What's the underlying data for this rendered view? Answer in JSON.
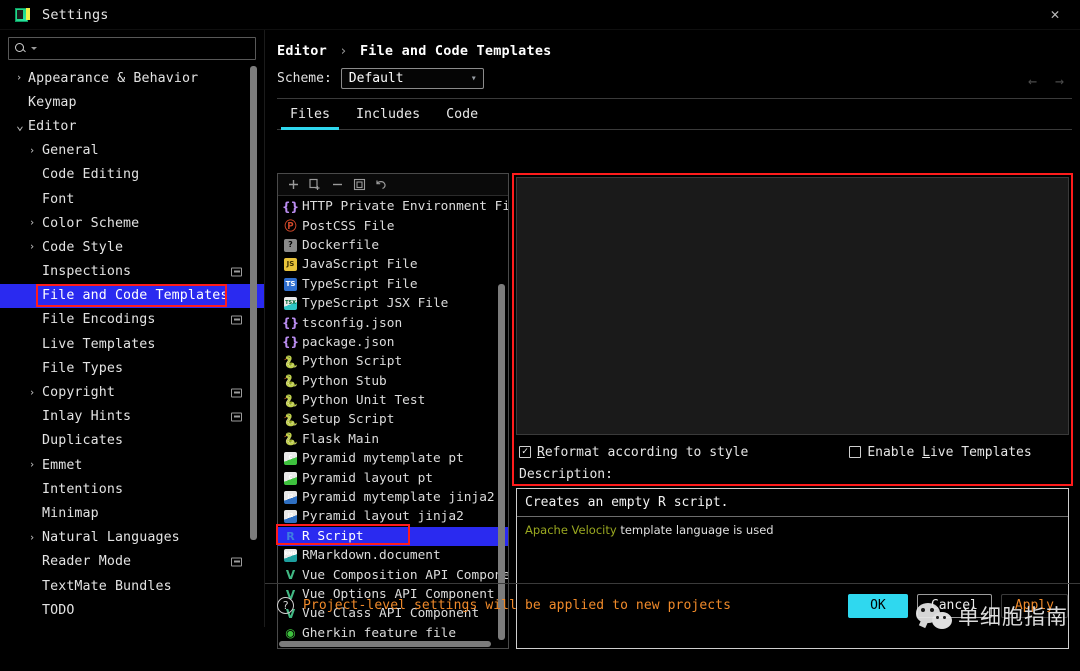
{
  "window": {
    "title": "Settings",
    "app_icon": "pycharm-icon",
    "close_icon": "close-icon"
  },
  "sidebar": {
    "search": {
      "placeholder": "",
      "value": "",
      "icon": "search-icon"
    },
    "items": [
      {
        "label": "Appearance & Behavior",
        "level": 1,
        "arrow": "collapsed",
        "badge": false
      },
      {
        "label": "Keymap",
        "level": 1,
        "arrow": "none",
        "badge": false
      },
      {
        "label": "Editor",
        "level": 1,
        "arrow": "expanded",
        "badge": false
      },
      {
        "label": "General",
        "level": 2,
        "arrow": "collapsed",
        "badge": false
      },
      {
        "label": "Code Editing",
        "level": 2,
        "arrow": "none",
        "badge": false
      },
      {
        "label": "Font",
        "level": 2,
        "arrow": "none",
        "badge": false
      },
      {
        "label": "Color Scheme",
        "level": 2,
        "arrow": "collapsed",
        "badge": false
      },
      {
        "label": "Code Style",
        "level": 2,
        "arrow": "collapsed",
        "badge": false
      },
      {
        "label": "Inspections",
        "level": 2,
        "arrow": "none",
        "badge": true
      },
      {
        "label": "File and Code Templates",
        "level": 2,
        "arrow": "none",
        "badge": false,
        "selected": true
      },
      {
        "label": "File Encodings",
        "level": 2,
        "arrow": "none",
        "badge": true
      },
      {
        "label": "Live Templates",
        "level": 2,
        "arrow": "none",
        "badge": false
      },
      {
        "label": "File Types",
        "level": 2,
        "arrow": "none",
        "badge": false
      },
      {
        "label": "Copyright",
        "level": 2,
        "arrow": "collapsed",
        "badge": true
      },
      {
        "label": "Inlay Hints",
        "level": 2,
        "arrow": "none",
        "badge": true
      },
      {
        "label": "Duplicates",
        "level": 2,
        "arrow": "none",
        "badge": false
      },
      {
        "label": "Emmet",
        "level": 2,
        "arrow": "collapsed",
        "badge": false
      },
      {
        "label": "Intentions",
        "level": 2,
        "arrow": "none",
        "badge": false
      },
      {
        "label": "Minimap",
        "level": 2,
        "arrow": "none",
        "badge": false
      },
      {
        "label": "Natural Languages",
        "level": 2,
        "arrow": "collapsed",
        "badge": false
      },
      {
        "label": "Reader Mode",
        "level": 2,
        "arrow": "none",
        "badge": true
      },
      {
        "label": "TextMate Bundles",
        "level": 2,
        "arrow": "none",
        "badge": false
      },
      {
        "label": "TODO",
        "level": 2,
        "arrow": "none",
        "badge": false
      }
    ]
  },
  "main": {
    "breadcrumb": {
      "parent": "Editor",
      "separator": "›",
      "current": "File and Code Templates"
    },
    "scheme": {
      "label": "Scheme:",
      "value": "Default",
      "chevron": "chevron-down-icon"
    },
    "tabs": [
      {
        "label": "Files",
        "active": true
      },
      {
        "label": "Includes",
        "active": false
      },
      {
        "label": "Code",
        "active": false
      }
    ],
    "nav": {
      "back_icon": "arrow-left-icon",
      "forward_icon": "arrow-right-icon"
    }
  },
  "list_toolbar": {
    "add": "plus-icon",
    "copy": "copy-add-icon",
    "remove": "minus-icon",
    "clone": "clone-icon",
    "reset": "undo-icon"
  },
  "templates": [
    {
      "name": "HTTP Private Environment Fil",
      "icon": "json-braces-icon",
      "kind": "json"
    },
    {
      "name": "PostCSS File",
      "icon": "postcss-icon",
      "kind": "postcss",
      "glyph": "Ⓟ"
    },
    {
      "name": "Dockerfile",
      "icon": "docker-icon",
      "kind": "docker",
      "glyph": "?"
    },
    {
      "name": "JavaScript File",
      "icon": "javascript-icon",
      "kind": "js",
      "glyph": "JS"
    },
    {
      "name": "TypeScript File",
      "icon": "typescript-icon",
      "kind": "ts",
      "glyph": "TS"
    },
    {
      "name": "TypeScript JSX File",
      "icon": "typescript-jsx-icon",
      "kind": "tsx",
      "glyph": "TSX"
    },
    {
      "name": "tsconfig.json",
      "icon": "json-braces-icon",
      "kind": "json"
    },
    {
      "name": "package.json",
      "icon": "json-braces-icon",
      "kind": "json"
    },
    {
      "name": "Python Script",
      "icon": "python-icon",
      "kind": "py"
    },
    {
      "name": "Python Stub",
      "icon": "python-icon",
      "kind": "py"
    },
    {
      "name": "Python Unit Test",
      "icon": "python-icon",
      "kind": "py"
    },
    {
      "name": "Setup Script",
      "icon": "python-icon",
      "kind": "py"
    },
    {
      "name": "Flask Main",
      "icon": "python-icon",
      "kind": "py"
    },
    {
      "name": "Pyramid mytemplate pt",
      "icon": "pyramid-pt-icon",
      "kind": "pyr",
      "glyph": "C"
    },
    {
      "name": "Pyramid layout pt",
      "icon": "pyramid-pt-icon",
      "kind": "pyr",
      "glyph": "C"
    },
    {
      "name": "Pyramid mytemplate jinja2",
      "icon": "pyramid-jinja2-icon",
      "kind": "pyrj",
      "glyph": "J2"
    },
    {
      "name": "Pyramid layout jinja2",
      "icon": "pyramid-jinja2-icon",
      "kind": "pyrj",
      "glyph": "J2"
    },
    {
      "name": "R Script",
      "icon": "r-icon",
      "kind": "r",
      "glyph": "R",
      "selected": true
    },
    {
      "name": "RMarkdown.document",
      "icon": "rmarkdown-icon",
      "kind": "rmd",
      "glyph": "RMD"
    },
    {
      "name": "Vue Composition API Compone",
      "icon": "vue-icon",
      "kind": "vue",
      "glyph": "V"
    },
    {
      "name": "Vue Options API Component",
      "icon": "vue-icon",
      "kind": "vue",
      "glyph": "V"
    },
    {
      "name": "Vue Class API Component",
      "icon": "vue-icon",
      "kind": "vue",
      "glyph": "V"
    },
    {
      "name": "Gherkin feature file",
      "icon": "gherkin-icon",
      "kind": "gherkin",
      "glyph": "◉"
    }
  ],
  "editor": {
    "content": ""
  },
  "options": {
    "reformat": {
      "label_pre": "R",
      "label_rest": "eformat according to style",
      "checked": true,
      "check_glyph": "✓"
    },
    "live_templates": {
      "label_pre": "Enable ",
      "label_u": "L",
      "label_rest": "ive Templates",
      "checked": false
    }
  },
  "description": {
    "label": "Description:",
    "line1": "Creates an empty R script.",
    "hint_link": "Apache Velocity",
    "hint_rest": " template language is used"
  },
  "footer": {
    "help_icon": "help-icon",
    "message": "Project-level settings will be applied to new projects",
    "ok": "OK",
    "cancel": "Cancel",
    "apply": "Apply"
  },
  "watermark": {
    "text": "单细胞指南",
    "logo": "wechat-logo"
  },
  "colors": {
    "selection_blue": "#2a2af0",
    "accent_cyan": "#2fd8ef",
    "annotation_red": "#ff1c1c",
    "warning_orange": "#f08a2a"
  }
}
